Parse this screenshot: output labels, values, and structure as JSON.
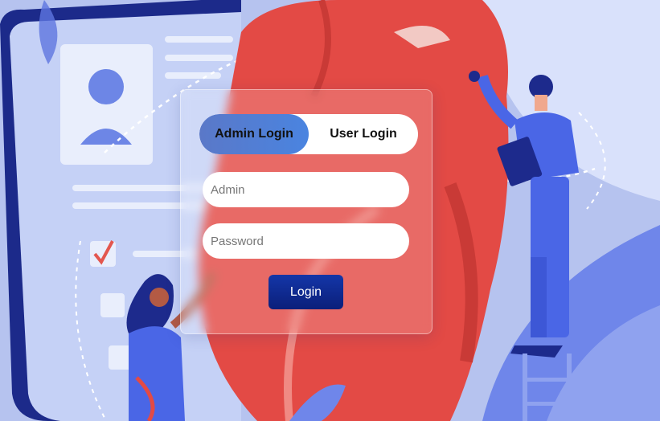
{
  "login_card": {
    "tabs": [
      {
        "label": "Admin Login",
        "active": true
      },
      {
        "label": "User Login",
        "active": false
      }
    ],
    "username_placeholder": "Admin",
    "password_placeholder": "Password",
    "submit_label": "Login"
  },
  "colors": {
    "accent_tab": "#4f7fd6",
    "button": "#0b2a8f",
    "heart": "#e34a45",
    "figure_blue": "#4a66e6"
  },
  "background": {
    "illustration": "medical-heart-doctors-illustration"
  }
}
